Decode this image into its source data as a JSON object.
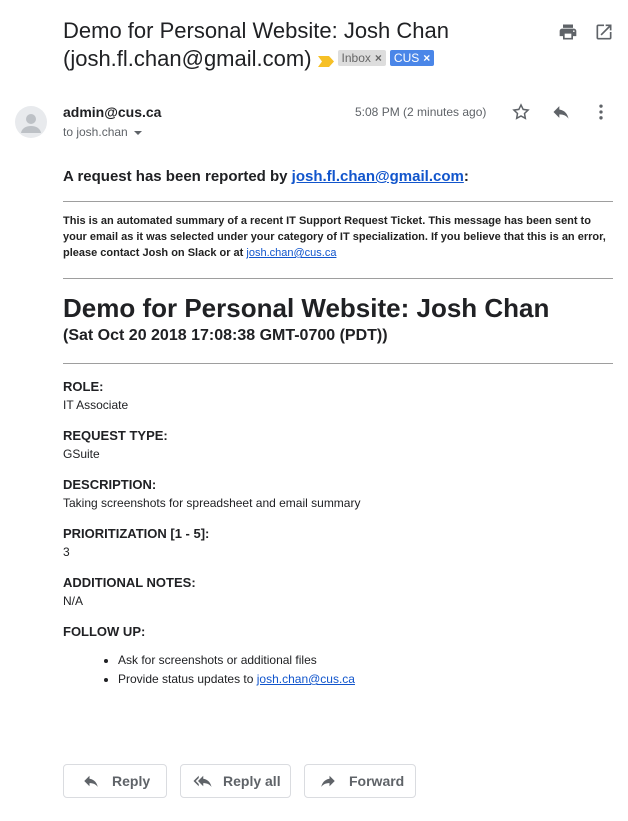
{
  "subject": {
    "title": "Demo for Personal Website: Josh Chan (josh.fl.chan@gmail.com)",
    "labels": [
      {
        "name": "Inbox",
        "remove": "×"
      },
      {
        "name": "CUS",
        "remove": "×"
      }
    ]
  },
  "toolbar_icons": [
    "print-icon",
    "open-in-new-window-icon"
  ],
  "message": {
    "sender": "admin@cus.ca",
    "recipient": "to josh.chan",
    "timestamp": "5:08 PM (2 minutes ago)",
    "icons": [
      "star-icon",
      "reply-icon",
      "more-options-icon"
    ]
  },
  "body": {
    "reported_prefix": "A request has been reported by ",
    "reported_email": "josh.fl.chan@gmail.com",
    "reported_suffix": ":",
    "summary_text": "This is an automated summary of a recent IT Support Request Ticket. This message has been sent to your email as it was selected under your category of IT specialization. If you believe that this is an error, please contact Josh on Slack or at ",
    "summary_email": "josh.chan@cus.ca",
    "ticket_title": "Demo for Personal Website: Josh Chan",
    "ticket_date": "(Sat Oct 20 2018 17:08:38 GMT-0700 (PDT))",
    "fields": [
      {
        "label": "ROLE:",
        "value": "IT Associate"
      },
      {
        "label": "REQUEST TYPE:",
        "value": "GSuite"
      },
      {
        "label": "DESCRIPTION:",
        "value": "Taking screenshots for spreadsheet and email summary"
      },
      {
        "label": "PRIORITIZATION [1 - 5]:",
        "value": "3"
      },
      {
        "label": "ADDITIONAL NOTES:",
        "value": "N/A"
      }
    ],
    "follow_up_label": "FOLLOW UP:",
    "follow_up_1": "Ask for screenshots or additional files",
    "follow_up_2_prefix": "Provide status updates to ",
    "follow_up_2_email": "josh.chan@cus.ca"
  },
  "reply_bar": {
    "reply": "Reply",
    "reply_all": "Reply all",
    "forward": "Forward"
  },
  "colors": {
    "link": "#1155cc",
    "label_cus": "#4a86e8",
    "label_inbox": "#dddddd",
    "importance_marker": "#f6c026"
  }
}
